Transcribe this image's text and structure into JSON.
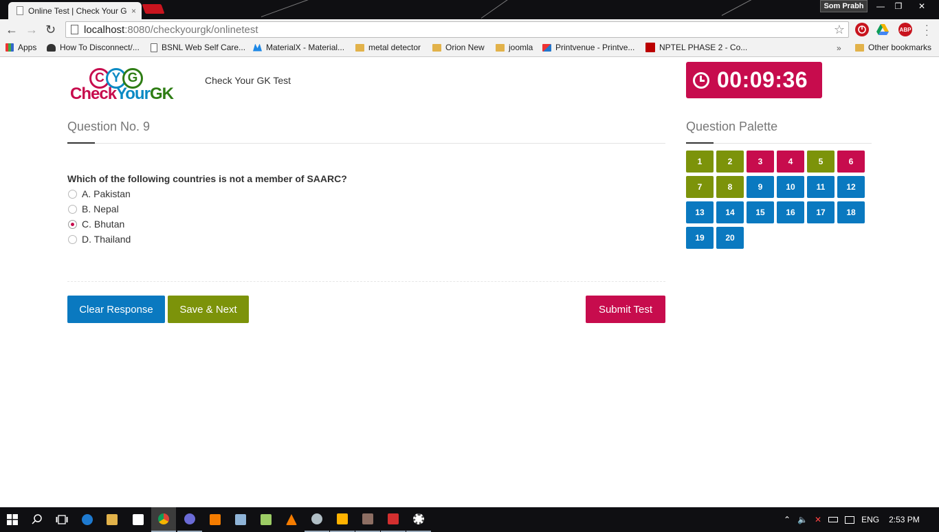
{
  "browser": {
    "tab_title": "Online Test | Check Your G",
    "tab_close": "×",
    "profile_name": "Som Prabh",
    "window_controls": {
      "minimize": "—",
      "restore": "❐",
      "close": "✕"
    },
    "nav": {
      "back": "←",
      "forward": "→",
      "reload": "↻"
    },
    "url_host": "localhost",
    "url_path": ":8080/checkyourgk/onlinetest",
    "bookmark_star": "☆",
    "extensions": [
      "stop-icon",
      "drive-icon",
      "abp-icon"
    ],
    "abp_label": "ABP",
    "bookmarks": [
      {
        "label": "Apps",
        "icon": "apps-grid-icon"
      },
      {
        "label": "How To Disconnect/...",
        "icon": "phone-icon"
      },
      {
        "label": "BSNL Web Self Care...",
        "icon": "page-icon"
      },
      {
        "label": "MaterialX - Material...",
        "icon": "materialx-icon"
      },
      {
        "label": "metal detector",
        "icon": "folder-icon"
      },
      {
        "label": "Orion New",
        "icon": "folder-icon"
      },
      {
        "label": "joomla",
        "icon": "folder-icon"
      },
      {
        "label": "Printvenue - Printve...",
        "icon": "printvenue-icon"
      },
      {
        "label": "NPTEL PHASE 2 - Co...",
        "icon": "nptel-icon"
      }
    ],
    "more_bookmarks": "»",
    "other_bookmarks": "Other bookmarks"
  },
  "header": {
    "logo_letters": [
      "C",
      "Y",
      "G"
    ],
    "logo_word": {
      "part1": "Check",
      "part2": "Your",
      "part3": "GK"
    },
    "site_title": "Check Your GK Test",
    "timer": "00:09:36"
  },
  "question": {
    "heading": "Question No. 9",
    "text": "Which of the following countries is not a member of SAARC?",
    "options": [
      {
        "label": "A. Pakistan",
        "checked": false
      },
      {
        "label": "B. Nepal",
        "checked": false
      },
      {
        "label": "C. Bhutan",
        "checked": true
      },
      {
        "label": "D. Thailand",
        "checked": false
      }
    ]
  },
  "actions": {
    "clear": "Clear Response",
    "save_next": "Save & Next",
    "submit": "Submit Test"
  },
  "palette": {
    "heading": "Question Palette",
    "items": [
      {
        "n": "1",
        "status": "answered"
      },
      {
        "n": "2",
        "status": "answered"
      },
      {
        "n": "3",
        "status": "skipped"
      },
      {
        "n": "4",
        "status": "skipped"
      },
      {
        "n": "5",
        "status": "answered"
      },
      {
        "n": "6",
        "status": "skipped"
      },
      {
        "n": "7",
        "status": "answered"
      },
      {
        "n": "8",
        "status": "answered"
      },
      {
        "n": "9",
        "status": "unvisited"
      },
      {
        "n": "10",
        "status": "unvisited"
      },
      {
        "n": "11",
        "status": "unvisited"
      },
      {
        "n": "12",
        "status": "unvisited"
      },
      {
        "n": "13",
        "status": "unvisited"
      },
      {
        "n": "14",
        "status": "unvisited"
      },
      {
        "n": "15",
        "status": "unvisited"
      },
      {
        "n": "16",
        "status": "unvisited"
      },
      {
        "n": "17",
        "status": "unvisited"
      },
      {
        "n": "18",
        "status": "unvisited"
      },
      {
        "n": "19",
        "status": "unvisited"
      },
      {
        "n": "20",
        "status": "unvisited"
      }
    ]
  },
  "colors": {
    "answered": "#7c930a",
    "skipped": "#c70c4d",
    "unvisited": "#0a79c0"
  },
  "taskbar": {
    "language": "ENG",
    "time": "2:53 PM"
  }
}
